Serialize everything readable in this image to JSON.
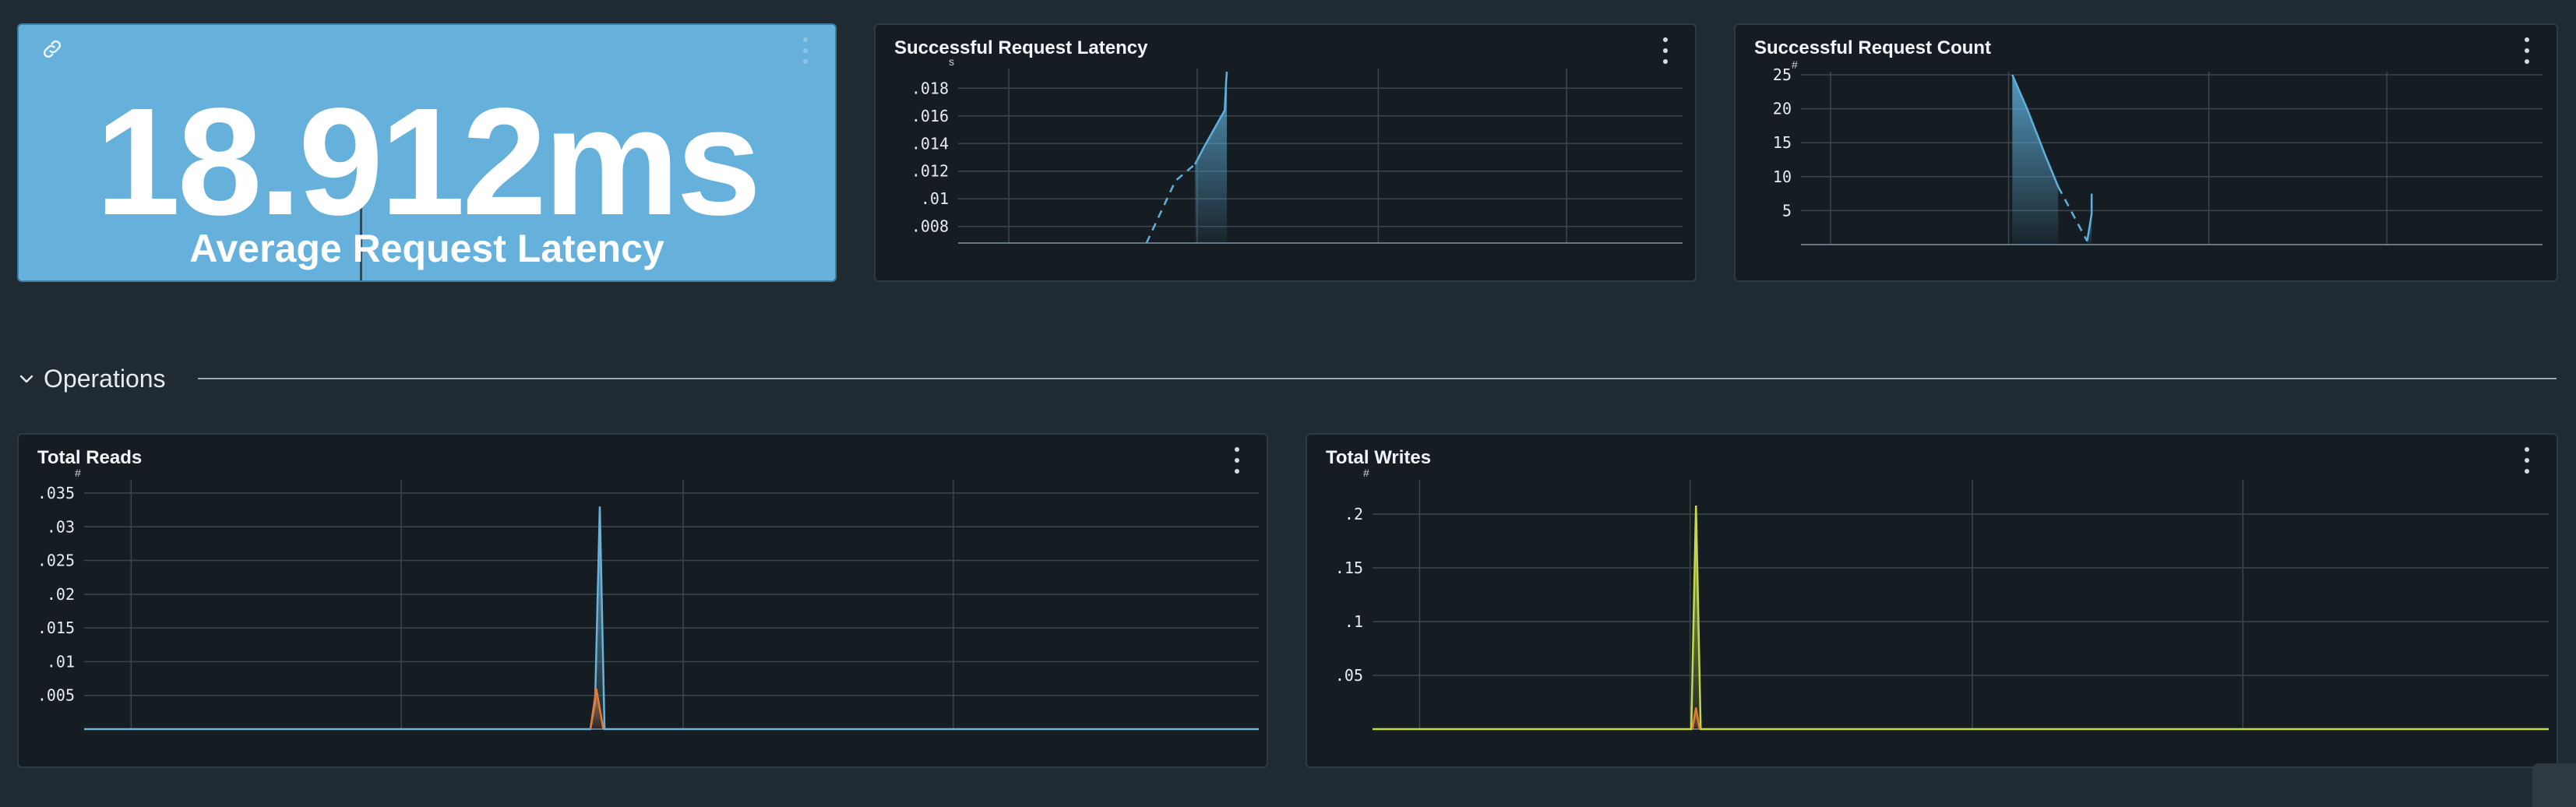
{
  "stat": {
    "value": "18.912ms",
    "label": "Average Request Latency",
    "background": "#66b1db"
  },
  "section": {
    "title": "Operations"
  },
  "icons": {
    "link": "link-icon",
    "menu": "kebab-menu-icon",
    "chevron": "chevron-down-icon",
    "resize": "resize-handle-icon"
  },
  "chart_data": [
    {
      "id": "latency",
      "type": "area",
      "title": "Successful Request Latency",
      "unit": "s",
      "yticks": [
        ".008",
        ".01",
        ".012",
        ".014",
        ".016",
        ".018"
      ],
      "ytick_values": [
        0.008,
        0.01,
        0.012,
        0.014,
        0.016,
        0.018
      ],
      "ylim": [
        0.0068,
        0.0192
      ],
      "xlim": [
        0,
        100
      ],
      "grid": true,
      "color": "#5fb0dc",
      "series": [
        {
          "style": "dashed",
          "x": [
            26.0,
            30.0,
            32.7
          ],
          "values": [
            0.0068,
            0.0113,
            0.0125
          ]
        },
        {
          "style": "solid",
          "x": [
            32.7,
            34.0,
            35.5,
            36.8,
            37.0,
            37.1
          ],
          "values": [
            0.0125,
            0.0138,
            0.0152,
            0.0164,
            0.0185,
            0.0192
          ]
        }
      ]
    },
    {
      "id": "count",
      "type": "area",
      "title": "Successful Request Count",
      "unit": "#",
      "yticks": [
        "5",
        "10",
        "15",
        "20",
        "25"
      ],
      "ytick_values": [
        5,
        10,
        15,
        20,
        25
      ],
      "ylim": [
        0,
        25
      ],
      "xlim": [
        0,
        100
      ],
      "grid": true,
      "color": "#5fb0dc",
      "series": [
        {
          "style": "solid",
          "x": [
            28.5,
            30.5,
            33.0,
            34.7
          ],
          "values": [
            25,
            20,
            13,
            8.5
          ]
        },
        {
          "style": "dashed",
          "x": [
            34.7,
            38.6
          ],
          "values": [
            8.5,
            0.5
          ]
        },
        {
          "style": "solid",
          "x": [
            38.6,
            39.2,
            39.2
          ],
          "values": [
            0.5,
            4.5,
            7.5
          ]
        }
      ]
    },
    {
      "id": "reads",
      "type": "area",
      "title": "Total Reads",
      "unit": "#",
      "yticks": [
        ".005",
        ".01",
        ".015",
        ".02",
        ".025",
        ".03",
        ".035"
      ],
      "ytick_values": [
        0.005,
        0.01,
        0.015,
        0.02,
        0.025,
        0.03,
        0.035
      ],
      "ylim": [
        0,
        0.0365
      ],
      "xlim": [
        0,
        100
      ],
      "grid": true,
      "series": [
        {
          "color": "#6bb2d8",
          "x": [
            0,
            43.1,
            43.5,
            43.9,
            44.3,
            100
          ],
          "values": [
            0,
            0,
            0.004,
            0.033,
            0,
            0
          ]
        },
        {
          "color": "#e07b3a",
          "x": [
            43.1,
            43.6,
            44.2
          ],
          "values": [
            0,
            0.006,
            0
          ]
        }
      ]
    },
    {
      "id": "writes",
      "type": "area",
      "title": "Total Writes",
      "unit": "#",
      "yticks": [
        ".05",
        ".1",
        ".15",
        ".2"
      ],
      "ytick_values": [
        0.05,
        0.1,
        0.15,
        0.2
      ],
      "ylim": [
        0,
        0.229
      ],
      "xlim": [
        0,
        100
      ],
      "grid": true,
      "series": [
        {
          "color": "#c3d94a",
          "x": [
            0,
            27.1,
            27.5,
            27.9,
            100
          ],
          "values": [
            0,
            0,
            0.208,
            0,
            0
          ]
        },
        {
          "color": "#e07b3a",
          "x": [
            27.2,
            27.5,
            27.8
          ],
          "values": [
            0,
            0.02,
            0
          ]
        }
      ]
    }
  ]
}
